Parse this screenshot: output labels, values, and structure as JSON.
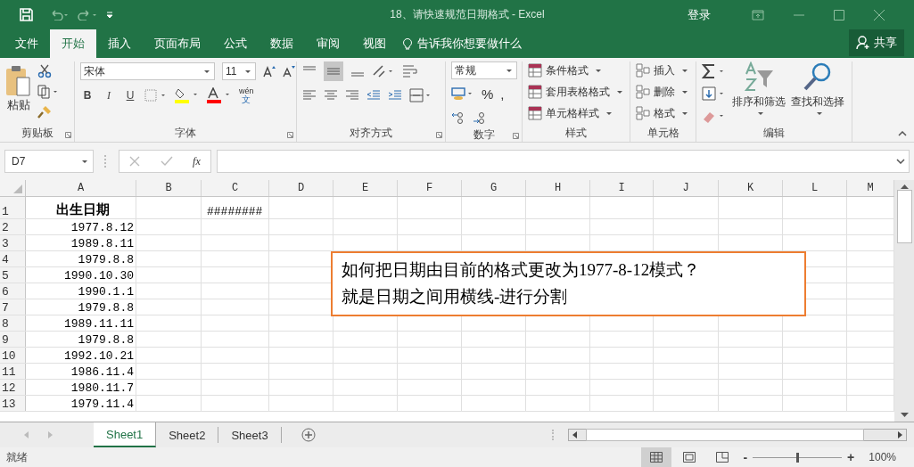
{
  "title_bar": {
    "title": "18、请快速规范日期格式  -  Excel",
    "sign_in": "登录"
  },
  "menu_tabs": [
    {
      "label": "文件",
      "selected": false
    },
    {
      "label": "开始",
      "selected": true
    },
    {
      "label": "插入",
      "selected": false
    },
    {
      "label": "页面布局",
      "selected": false
    },
    {
      "label": "公式",
      "selected": false
    },
    {
      "label": "数据",
      "selected": false
    },
    {
      "label": "审阅",
      "selected": false
    },
    {
      "label": "视图",
      "selected": false
    }
  ],
  "tell_me": "告诉我你想要做什么",
  "share": "共享",
  "ribbon": {
    "clipboard": {
      "paste": "粘贴",
      "label": "剪贴板"
    },
    "font": {
      "font_name": "宋体",
      "font_size": "11",
      "bold": "B",
      "italic": "I",
      "underline": "U",
      "phonetic_top": "wén",
      "phonetic_bottom": "文",
      "label": "字体"
    },
    "alignment": {
      "label": "对齐方式"
    },
    "number": {
      "format": "常规",
      "percent": "%",
      "comma": ",",
      "label": "数字"
    },
    "styles": {
      "items": [
        "条件格式",
        "套用表格格式",
        "单元格样式"
      ],
      "label": "样式"
    },
    "cells": {
      "items": [
        "插入",
        "删除",
        "格式"
      ],
      "label": "单元格"
    },
    "editing": {
      "sort": "排序和筛选",
      "find": "查找和选择",
      "label": "编辑"
    }
  },
  "formula_bar": {
    "name_box": "D7",
    "fx": "fx"
  },
  "columns": [
    "A",
    "B",
    "C",
    "D",
    "E",
    "F",
    "G",
    "H",
    "I",
    "J",
    "K",
    "L",
    "M"
  ],
  "rows": [
    {
      "number": "1",
      "birth_date": "出生日期",
      "column_c": "########"
    },
    {
      "number": "2",
      "birth_date": "1977.8.12"
    },
    {
      "number": "3",
      "birth_date": "1989.8.11"
    },
    {
      "number": "4",
      "birth_date": "1979.8.8"
    },
    {
      "number": "5",
      "birth_date": "1990.10.30"
    },
    {
      "number": "6",
      "birth_date": "1990.1.1"
    },
    {
      "number": "7",
      "birth_date": "1979.8.8"
    },
    {
      "number": "8",
      "birth_date": "1989.11.11"
    },
    {
      "number": "9",
      "birth_date": "1979.8.8"
    },
    {
      "number": "10",
      "birth_date": "1992.10.21"
    },
    {
      "number": "11",
      "birth_date": "1986.11.4"
    },
    {
      "number": "12",
      "birth_date": "1980.11.7"
    },
    {
      "number": "13",
      "birth_date": "1979.11.4"
    }
  ],
  "text_box": {
    "lines": [
      "如何把日期由目前的格式更改为1977-8-12模式？",
      "就是日期之间用横线-进行分割"
    ]
  },
  "sheet_tabs": [
    {
      "label": "Sheet1",
      "selected": true
    },
    {
      "label": "Sheet2",
      "selected": false
    },
    {
      "label": "Sheet3",
      "selected": false
    }
  ],
  "status_bar": {
    "status": "就绪",
    "views": [
      {
        "kind": "normal",
        "selected": true
      },
      {
        "kind": "page_layout",
        "selected": false
      },
      {
        "kind": "page_break",
        "selected": false
      }
    ],
    "zoom_minus": "-",
    "zoom_slider": {
      "level": 0.5
    },
    "zoom_plus": "+",
    "zoom": "100%"
  }
}
